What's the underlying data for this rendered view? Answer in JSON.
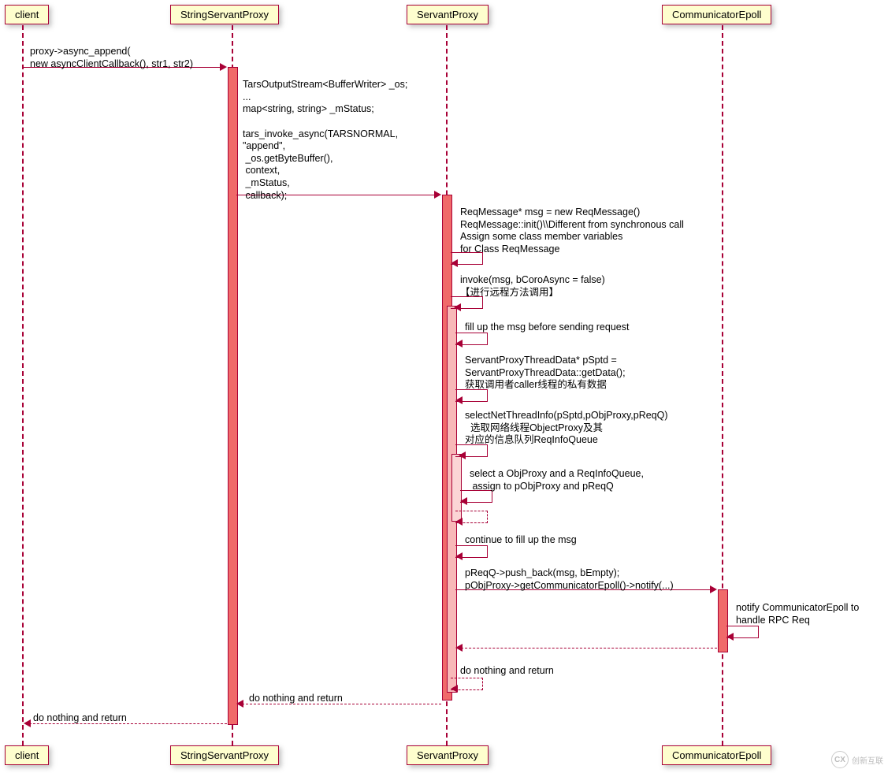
{
  "participants": {
    "client": "client",
    "stringServantProxy": "StringServantProxy",
    "servantProxy": "ServantProxy",
    "communicatorEpoll": "CommunicatorEpoll"
  },
  "messages": {
    "m1": "proxy->async_append(\nnew asyncClientCallback(), str1, str2)",
    "m2": "TarsOutputStream<BufferWriter> _os;\n...\nmap<string, string> _mStatus;\n\ntars_invoke_async(TARSNORMAL,\n\"append\",\n _os.getByteBuffer(),\n context,\n _mStatus,\n callback);",
    "m3": "ReqMessage* msg = new ReqMessage()\nReqMessage::init()\\\\Different from synchronous call\nAssign some class member variables\nfor Class ReqMessage",
    "m4": "invoke(msg, bCoroAsync = false)\n【进行远程方法调用】",
    "m5": "fill up the msg before sending request",
    "m6": "ServantProxyThreadData* pSptd =\nServantProxyThreadData::getData();\n获取调用者caller线程的私有数据",
    "m7": "selectNetThreadInfo(pSptd,pObjProxy,pReqQ)\n  选取网络线程ObjectProxy及其\n对应的信息队列ReqInfoQueue",
    "m8": "select a ObjProxy and a ReqInfoQueue,\n assign to pObjProxy and pReqQ",
    "m9": "continue to fill up the msg",
    "m10": "pReqQ->push_back(msg, bEmpty);\npObjProxy->getCommunicatorEpoll()->notify(...)",
    "m11": "notify CommunicatorEpoll to\nhandle RPC Req",
    "m12": "do nothing and return",
    "m13": "do nothing and return",
    "m14": "do nothing and return"
  },
  "watermark": {
    "symbol": "CX",
    "text": "创新互联"
  },
  "chart_data": {
    "type": "sequence_diagram",
    "participants": [
      "client",
      "StringServantProxy",
      "ServantProxy",
      "CommunicatorEpoll"
    ],
    "messages": [
      {
        "from": "client",
        "to": "StringServantProxy",
        "kind": "sync",
        "label": "proxy->async_append(new asyncClientCallback(), str1, str2)"
      },
      {
        "from": "StringServantProxy",
        "to": "ServantProxy",
        "kind": "sync",
        "label": "TarsOutputStream<BufferWriter> _os; ... map<string,string> _mStatus; tars_invoke_async(TARSNORMAL, \"append\", _os.getByteBuffer(), context, _mStatus, callback);"
      },
      {
        "from": "ServantProxy",
        "to": "ServantProxy",
        "kind": "self",
        "label": "ReqMessage* msg = new ReqMessage(); ReqMessage::init() \\\\Different from synchronous call; Assign some class member variables for Class ReqMessage"
      },
      {
        "from": "ServantProxy",
        "to": "ServantProxy",
        "kind": "self",
        "label": "invoke(msg, bCoroAsync = false) 【进行远程方法调用】"
      },
      {
        "from": "ServantProxy",
        "to": "ServantProxy",
        "kind": "self",
        "label": "fill up the msg before sending request"
      },
      {
        "from": "ServantProxy",
        "to": "ServantProxy",
        "kind": "self",
        "label": "ServantProxyThreadData* pSptd = ServantProxyThreadData::getData(); 获取调用者caller线程的私有数据"
      },
      {
        "from": "ServantProxy",
        "to": "ServantProxy",
        "kind": "self",
        "label": "selectNetThreadInfo(pSptd,pObjProxy,pReqQ) 选取网络线程ObjectProxy及其对应的信息队列ReqInfoQueue"
      },
      {
        "from": "ServantProxy",
        "to": "ServantProxy",
        "kind": "self",
        "label": "select a ObjProxy and a ReqInfoQueue, assign to pObjProxy and pReqQ"
      },
      {
        "from": "ServantProxy",
        "to": "ServantProxy",
        "kind": "self",
        "label": "continue to fill up the msg"
      },
      {
        "from": "ServantProxy",
        "to": "CommunicatorEpoll",
        "kind": "sync",
        "label": "pReqQ->push_back(msg, bEmpty); pObjProxy->getCommunicatorEpoll()->notify(...)"
      },
      {
        "from": "CommunicatorEpoll",
        "to": "CommunicatorEpoll",
        "kind": "self",
        "label": "notify CommunicatorEpoll to handle RPC Req"
      },
      {
        "from": "CommunicatorEpoll",
        "to": "ServantProxy",
        "kind": "return",
        "label": ""
      },
      {
        "from": "ServantProxy",
        "to": "ServantProxy",
        "kind": "return-self",
        "label": "do nothing and return"
      },
      {
        "from": "ServantProxy",
        "to": "StringServantProxy",
        "kind": "return",
        "label": "do nothing and return"
      },
      {
        "from": "StringServantProxy",
        "to": "client",
        "kind": "return",
        "label": "do nothing and return"
      }
    ]
  }
}
